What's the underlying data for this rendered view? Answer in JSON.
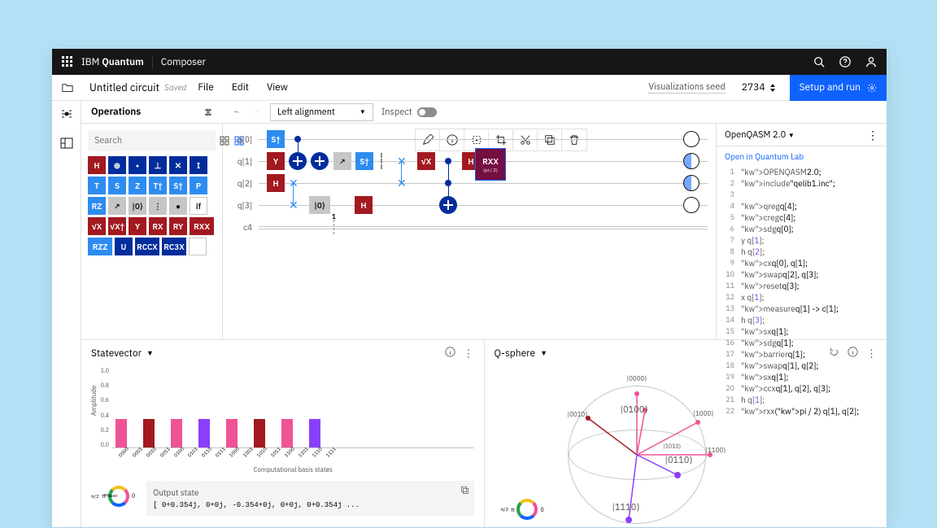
{
  "topbar": {
    "brand_prefix": "IBM ",
    "brand_bold": "Quantum",
    "app_name": "Composer"
  },
  "header": {
    "circuit_title": "Untitled circuit",
    "saved_label": "Saved",
    "menu": [
      "File",
      "Edit",
      "View"
    ],
    "viz_seed_label": "Visualizations seed",
    "viz_seed_value": "2734",
    "setup_run": "Setup and run"
  },
  "operations": {
    "title": "Operations",
    "search_placeholder": "Search",
    "gates": [
      {
        "label": "H",
        "cls": "red"
      },
      {
        "label": "⊕",
        "cls": "navy"
      },
      {
        "label": "•",
        "cls": "navy"
      },
      {
        "label": "⊥",
        "cls": "navy"
      },
      {
        "label": "✕",
        "cls": "navy"
      },
      {
        "label": "I",
        "cls": "navy"
      },
      {
        "label": "T",
        "cls": "blue"
      },
      {
        "label": "S",
        "cls": "blue"
      },
      {
        "label": "Z",
        "cls": "blue"
      },
      {
        "label": "T†",
        "cls": "blue"
      },
      {
        "label": "S†",
        "cls": "blue"
      },
      {
        "label": "P",
        "cls": "blue"
      },
      {
        "label": "RZ",
        "cls": "blue"
      },
      {
        "label": "↗",
        "cls": "grey"
      },
      {
        "label": "|0⟩",
        "cls": "grey"
      },
      {
        "label": "⋮",
        "cls": "grey"
      },
      {
        "label": "●",
        "cls": "grey"
      },
      {
        "label": "if",
        "cls": "white"
      },
      {
        "label": "√X",
        "cls": "red"
      },
      {
        "label": "√X†",
        "cls": "red"
      },
      {
        "label": "Y",
        "cls": "red"
      },
      {
        "label": "RX",
        "cls": "red"
      },
      {
        "label": "RY",
        "cls": "red"
      },
      {
        "label": "RXX",
        "cls": "red lg"
      },
      {
        "label": "RZZ",
        "cls": "blue lg"
      },
      {
        "label": "U",
        "cls": "navy"
      },
      {
        "label": "RCCX",
        "cls": "navy lg"
      },
      {
        "label": "RC3X",
        "cls": "navy lg"
      },
      {
        "label": "◔",
        "cls": "phase"
      }
    ]
  },
  "canvas": {
    "toolbar": {
      "align_label": "Left alignment",
      "inspect_label": "Inspect"
    },
    "qubits": [
      "q[0]",
      "q[1]",
      "q[2]",
      "q[3]",
      "c4"
    ],
    "rxx_label": "RXX",
    "rxx_params": "(pi / 2)",
    "step_marker": "1"
  },
  "code": {
    "panel_title": "OpenQASM 2.0",
    "open_link": "Open in Quantum Lab",
    "lines": [
      "OPENQASM 2.0;",
      "include \"qelib1.inc\";",
      "",
      "qreg q[4];",
      "creg c[4];",
      "sdg q[0];",
      "y q[1];",
      "h q[2];",
      "cx q[0], q[1];",
      "swap q[2], q[3];",
      "reset q[3];",
      "x q[1];",
      "measure q[1] -> c[1];",
      "h q[3];",
      "sx q[1];",
      "sdg q[1];",
      "barrier q[1];",
      "swap q[1], q[2];",
      "sx q[1];",
      "ccx q[1], q[2], q[3];",
      "h q[1];",
      "rxx(pi / 2) q[1], q[2];"
    ]
  },
  "statevector": {
    "title": "Statevector",
    "y_label": "Amplitude",
    "x_label": "Computational basis states",
    "output_title": "Output state",
    "output_value": "[ 0+0.354j, 0+0j, -0.354+0j, 0+0j, 0+0.354j ...",
    "phase_label": "Phase"
  },
  "qsphere": {
    "title": "Q-sphere",
    "states": [
      "|0000⟩",
      "|0010⟩",
      "|0100⟩",
      "|1000⟩",
      "|0110⟩",
      "|1100⟩",
      "|1110⟩",
      "|1010⟩"
    ]
  },
  "chart_data": {
    "type": "bar",
    "title": "Statevector",
    "xlabel": "Computational basis states",
    "ylabel": "Amplitude",
    "ylim": [
      0,
      1.0
    ],
    "y_ticks": [
      1.0,
      0.8,
      0.6,
      0.4,
      0.2,
      0
    ],
    "categories": [
      "0000",
      "0001",
      "0010",
      "0011",
      "0100",
      "0101",
      "0110",
      "0111",
      "1000",
      "1001",
      "1010",
      "1011",
      "1100",
      "1101",
      "1110",
      "1111"
    ],
    "values": [
      0.35,
      0,
      0.35,
      0,
      0.35,
      0,
      0.35,
      0,
      0.35,
      0,
      0.35,
      0,
      0.35,
      0,
      0.35,
      0
    ],
    "colors": [
      "#ee5396",
      "",
      "#a2191f",
      "",
      "#ee5396",
      "",
      "#8a3ffc",
      "",
      "#ee5396",
      "",
      "#a2191f",
      "",
      "#ee5396",
      "",
      "#8a3ffc",
      ""
    ]
  }
}
